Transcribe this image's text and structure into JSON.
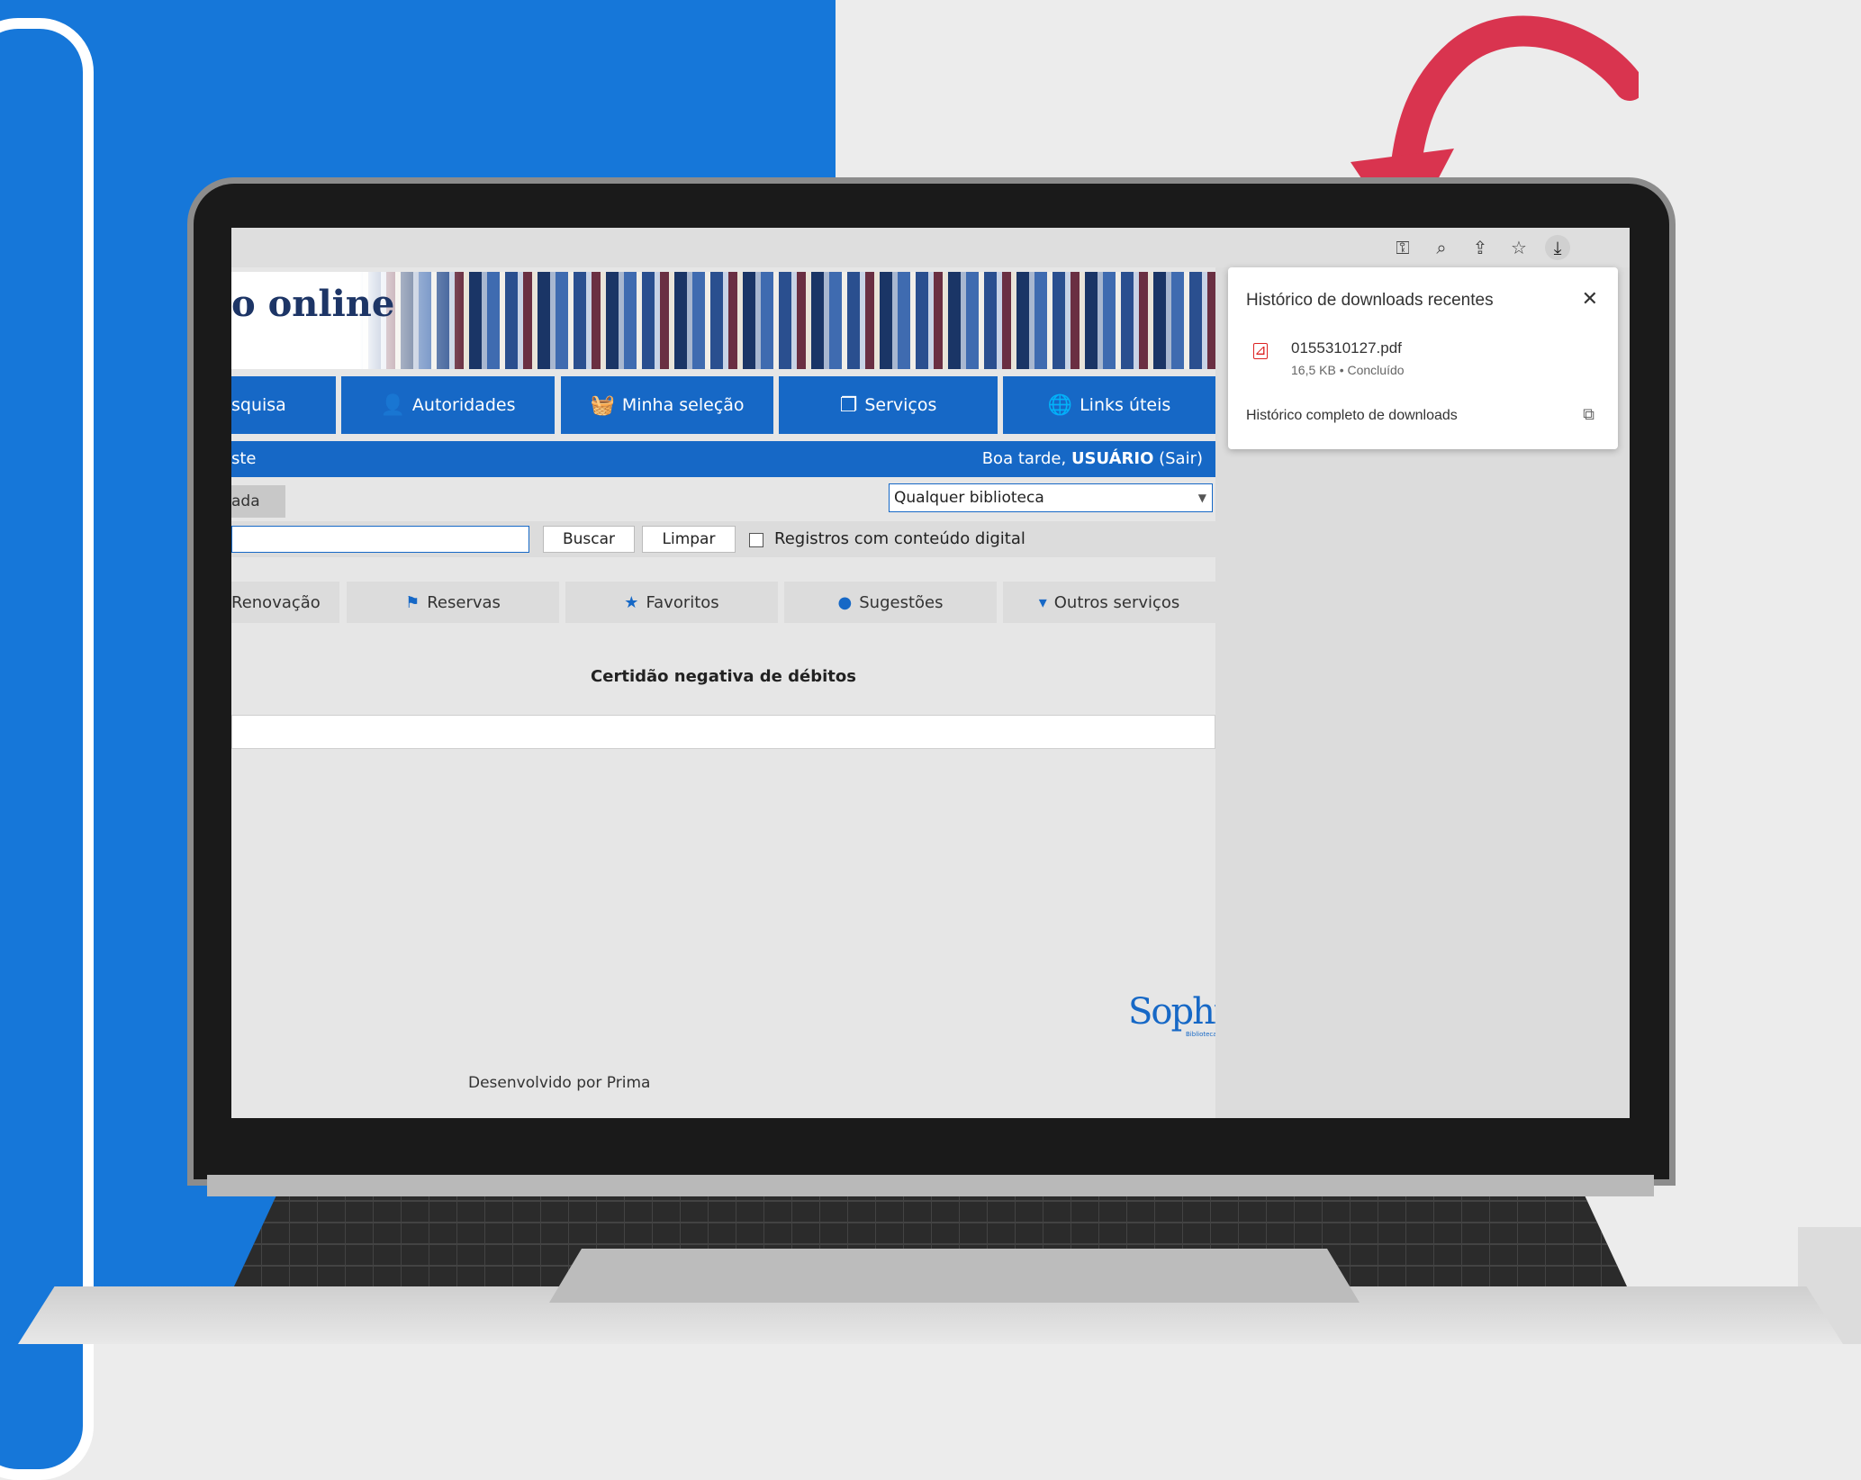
{
  "banner": {
    "title": "o online"
  },
  "nav": [
    {
      "label": "squisa",
      "icon": "search-icon"
    },
    {
      "label": "Autoridades",
      "icon": "user-icon"
    },
    {
      "label": "Minha seleção",
      "icon": "basket-icon"
    },
    {
      "label": "Serviços",
      "icon": "services-icon"
    },
    {
      "label": "Links úteis",
      "icon": "globe-icon"
    }
  ],
  "userbar": {
    "left": "ste",
    "greeting": "Boa tarde, ",
    "user": "USUÁRIO",
    "logout": " (Sair)"
  },
  "tab": {
    "label": "ada"
  },
  "library_select": {
    "value": "Qualquer biblioteca"
  },
  "search": {
    "buscar": "Buscar",
    "limpar": "Limpar",
    "digital_label": "Registros com conteúdo digital"
  },
  "services": [
    {
      "label": "Renovação",
      "icon": ""
    },
    {
      "label": "Reservas",
      "icon": "flag-icon"
    },
    {
      "label": "Favoritos",
      "icon": "star-icon"
    },
    {
      "label": "Sugestões",
      "icon": "lightbulb-icon"
    },
    {
      "label": "Outros serviços",
      "icon": "caret-down-icon"
    }
  ],
  "certificate": {
    "title": "Certidão negativa de débitos"
  },
  "logo": {
    "name": "SophiA",
    "sub": "Biblioteca"
  },
  "footer": {
    "text": "Desenvolvido por Prima"
  },
  "downloads": {
    "title": "Histórico de downloads recentes",
    "file_name": "0155310127.pdf",
    "file_meta": "16,5 KB • Concluído",
    "full_history": "Histórico completo de downloads"
  },
  "colors": {
    "brand": "#1668c6",
    "background_blue": "#1677d9",
    "arrow": "#d9344f"
  }
}
